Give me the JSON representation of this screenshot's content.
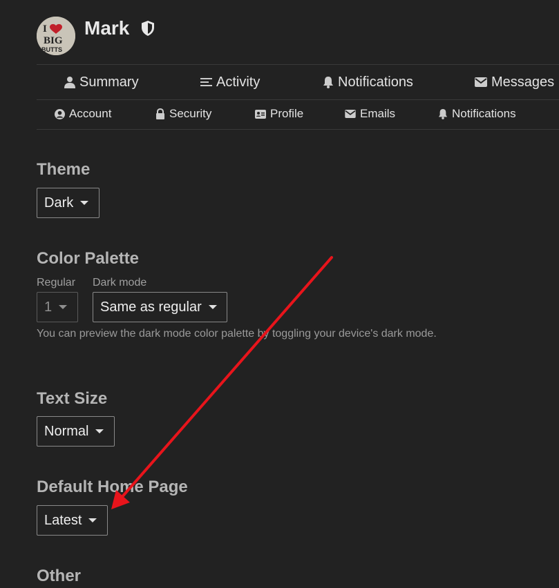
{
  "user": {
    "name": "Mark"
  },
  "primary_nav": [
    {
      "label": "Summary",
      "icon": "user-icon"
    },
    {
      "label": "Activity",
      "icon": "list-icon"
    },
    {
      "label": "Notifications",
      "icon": "bell-icon"
    },
    {
      "label": "Messages",
      "icon": "envelope-icon"
    }
  ],
  "secondary_nav": [
    {
      "label": "Account",
      "icon": "user-circle-icon"
    },
    {
      "label": "Security",
      "icon": "lock-icon"
    },
    {
      "label": "Profile",
      "icon": "id-card-icon"
    },
    {
      "label": "Emails",
      "icon": "envelope-icon"
    },
    {
      "label": "Notifications",
      "icon": "bell-icon"
    }
  ],
  "theme": {
    "heading": "Theme",
    "value": "Dark"
  },
  "color_palette": {
    "heading": "Color Palette",
    "regular_label": "Regular",
    "regular_value": "1",
    "dark_label": "Dark mode",
    "dark_value": "Same as regular",
    "hint": "You can preview the dark mode color palette by toggling your device's dark mode."
  },
  "text_size": {
    "heading": "Text Size",
    "value": "Normal"
  },
  "default_home_page": {
    "heading": "Default Home Page",
    "value": "Latest"
  },
  "other": {
    "heading": "Other"
  },
  "colors": {
    "background": "#222222",
    "annotation_arrow": "#e8141b"
  }
}
